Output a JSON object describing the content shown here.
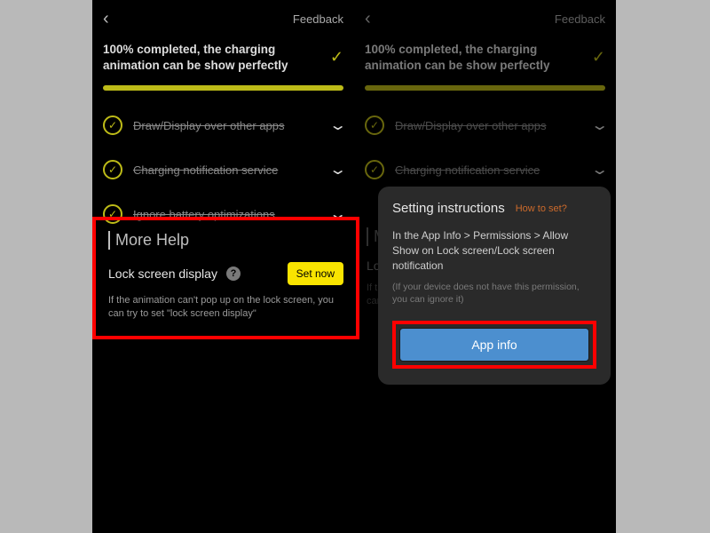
{
  "topbar": {
    "feedback": "Feedback"
  },
  "status": {
    "text": "100% completed, the charging animation can be show perfectly"
  },
  "items": [
    {
      "label": "Draw/Display over other apps",
      "strike": true
    },
    {
      "label": "Charging notification service",
      "strike": true
    },
    {
      "label": "Ignore battery optimizations",
      "strike": true
    }
  ],
  "morehelp": {
    "heading": "More Help",
    "lock_label": "Lock screen display",
    "set_now": "Set now",
    "help_text": "If the animation can't pop up on the lock screen, you can try to set \"lock screen display\""
  },
  "modal": {
    "title": "Setting instructions",
    "how": "How to set?",
    "text": "In the App Info > Permissions > Allow Show on Lock screen/Lock screen notification",
    "hint": "(If your device does not have this permission, you can ignore it)",
    "button": "App info"
  }
}
